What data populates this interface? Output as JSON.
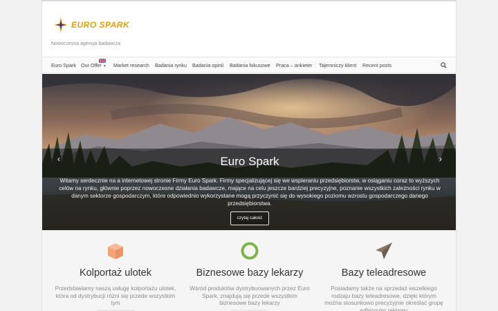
{
  "brand": {
    "logo_text": "EURO SPARK",
    "tagline": "Nowoczesna agencja badawcza",
    "logo_color": "#e6a000"
  },
  "nav": {
    "items": [
      {
        "label": "Euro Spark"
      },
      {
        "label": "Our Offer"
      },
      {
        "label": "Market research"
      },
      {
        "label": "Badania rynku"
      },
      {
        "label": "Badania opinii"
      },
      {
        "label": "Badania fokusowe"
      },
      {
        "label": "Praca – ankieter"
      },
      {
        "label": "Tajemniczy klient"
      },
      {
        "label": "Recent posts"
      }
    ],
    "search_icon": "search-icon",
    "flag_icon": "uk-flag-icon"
  },
  "hero": {
    "title": "Euro Spark",
    "text": "Witamy serdecznie na a internetowej stronie Firmy Euro Spark. Firmy specjalizującej się we wspieraniu przedsiębiorstw, w osiąganiu coraz to wyższych celów na rynku, głównie poprzez nowoczesne działania badawcze, mające na celu jeszcze bardziej precyzyjne, poznanie wszystkich zależności rynku w danym sektorze gospodarczym, które odpowiednio wykorzystane mogą przyczynić się do wysokiego poziomu wzrostu gospodarczego danego przedsiębiorstwa.",
    "button": "czytaj całość",
    "prev_icon": "chevron-left-icon",
    "next_icon": "chevron-right-icon"
  },
  "features": [
    {
      "title": "Kolportaż ulotek",
      "text": "Przedstawiamy naszą usługę kolportażu ulotek, która od dystrybucji różni się przede wszystkim tym",
      "icon": "box-icon",
      "color": "#f2a477"
    },
    {
      "title": "Biznesowe bazy lekarzy",
      "text": "Wśród produktów dystrybuowanych przez Euro Spark, znajdują się przede wszystkim biznesowe bazy lekarzy",
      "icon": "ring-icon",
      "color": "#7db446"
    },
    {
      "title": "Bazy teleadresowe",
      "text": "Posiadamy także na sprzedaż wszelkiego rodzaju bazy teleadresowe, dzięki którym można stosunkowo precyzyjnie określać grupę odbiorców reklamy",
      "icon": "paper-plane-icon",
      "color": "#8a7566"
    }
  ]
}
